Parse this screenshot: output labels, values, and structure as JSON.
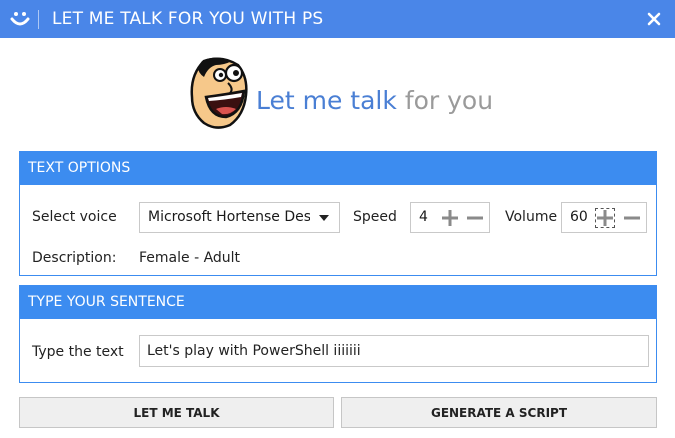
{
  "window": {
    "title": "LET ME TALK FOR YOU WITH PS",
    "app_icon": "smiley-face-icon",
    "close_icon": "close-icon"
  },
  "logo": {
    "image": "cartoon-face-logo",
    "text_strong": "Let me talk",
    "text_light": "for you"
  },
  "text_options": {
    "header": "TEXT OPTIONS",
    "select_voice_label": "Select voice",
    "voice_value": "Microsoft Hortense Desktop",
    "speed_label": "Speed",
    "speed_value": "4",
    "volume_label": "Volume",
    "volume_value": "60",
    "description_label": "Description:",
    "description_value": "Female - Adult"
  },
  "sentence": {
    "header": "TYPE YOUR SENTENCE",
    "type_label": "Type the text",
    "text_value": "Let's play with PowerShell iiiiiii"
  },
  "buttons": {
    "talk": "LET ME TALK",
    "script": "GENERATE A SCRIPT"
  },
  "colors": {
    "titlebar": "#4a86e8",
    "panel_header": "#3c8cf0",
    "logo_strong": "#4a7fd4",
    "logo_light": "#9a9a9a",
    "button_bg": "#efefef"
  }
}
